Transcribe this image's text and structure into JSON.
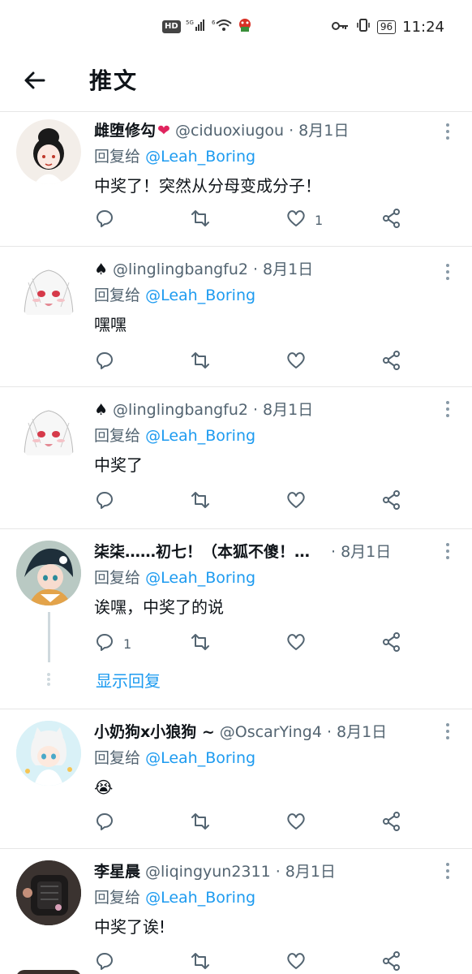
{
  "status": {
    "hd": "HD",
    "signal1": "5G",
    "signal2": "6",
    "battery": "96",
    "time": "11:24"
  },
  "header": {
    "title": "推文"
  },
  "replying_label": "回复给",
  "mention": "@Leah_Boring",
  "tweets": [
    {
      "name": "雌堕修勾",
      "name_emoji": "❤",
      "handle": "@ciduoxiugou",
      "time": "8月1日",
      "body": "中奖了！突然从分母变成分子！",
      "like_count": "1",
      "reply_count": ""
    },
    {
      "name": "♠",
      "name_emoji": "",
      "handle": "@linglingbangfu2",
      "time": "8月1日",
      "body": "嘿嘿",
      "like_count": "",
      "reply_count": ""
    },
    {
      "name": "♠",
      "name_emoji": "",
      "handle": "@linglingbangfu2",
      "time": "8月1日",
      "body": "中奖了",
      "like_count": "",
      "reply_count": ""
    },
    {
      "name": "柒柒……初七！（本狐不傻！…",
      "name_emoji": "",
      "handle": "",
      "time": "8月1日",
      "body": "诶嘿，中奖了的说",
      "like_count": "",
      "reply_count": "1",
      "show_replies": "显示回复"
    },
    {
      "name": "小奶狗x小狼狗 ~",
      "name_emoji": "",
      "handle": "@OscarYing4",
      "time": "8月1日",
      "body": "😭",
      "like_count": "",
      "reply_count": ""
    },
    {
      "name": "李星晨",
      "name_emoji": "",
      "handle": "@liqingyun2311",
      "time": "8月1日",
      "body": "中奖了诶!",
      "like_count": "",
      "reply_count": ""
    }
  ],
  "icons": {
    "reply": "reply-icon",
    "retweet": "retweet-icon",
    "like": "like-icon",
    "share": "share-icon",
    "more": "more-icon",
    "back": "back-arrow-icon"
  }
}
